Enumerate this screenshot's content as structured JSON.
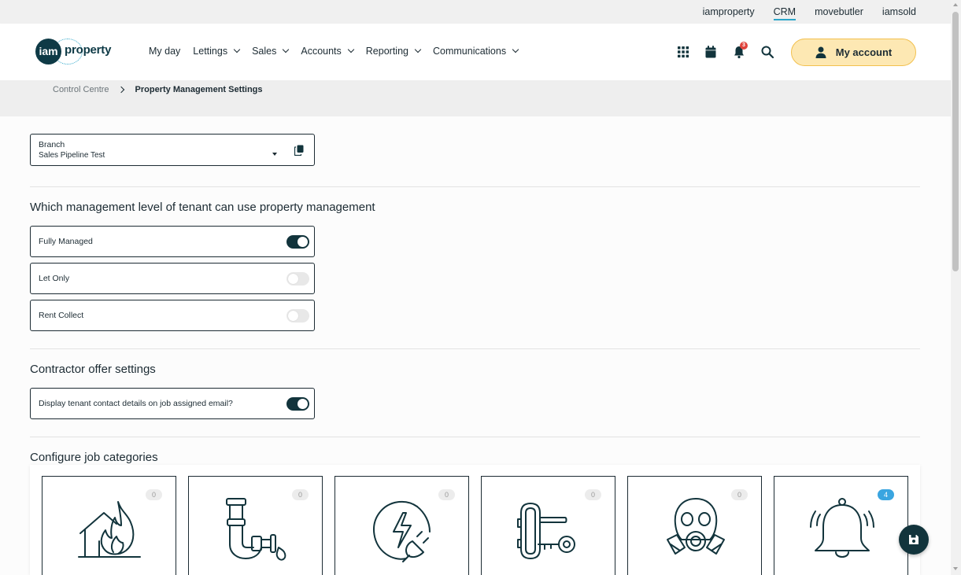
{
  "top_links": [
    {
      "label": "iamproperty",
      "active": false
    },
    {
      "label": "CRM",
      "active": true
    },
    {
      "label": "movebutler",
      "active": false
    },
    {
      "label": "iamsold",
      "active": false
    }
  ],
  "header": {
    "logo_mark": "iam",
    "logo_word": "property",
    "nav": [
      {
        "label": "My day",
        "has_dropdown": false
      },
      {
        "label": "Lettings",
        "has_dropdown": true
      },
      {
        "label": "Sales",
        "has_dropdown": true
      },
      {
        "label": "Accounts",
        "has_dropdown": true
      },
      {
        "label": "Reporting",
        "has_dropdown": true
      },
      {
        "label": "Communications",
        "has_dropdown": true
      }
    ],
    "icons": [
      "apps-grid-icon",
      "calendar-icon",
      "bell-icon",
      "search-icon"
    ],
    "notification_count": "3",
    "account_label": "My account"
  },
  "breadcrumb": {
    "parent": "Control Centre",
    "current": "Property Management Settings"
  },
  "branch": {
    "label": "Branch",
    "value": "Sales Pipeline Test"
  },
  "management": {
    "title": "Which management level of tenant can use property management",
    "options": [
      {
        "label": "Fully Managed",
        "enabled": true
      },
      {
        "label": "Let Only",
        "enabled": false
      },
      {
        "label": "Rent Collect",
        "enabled": false
      }
    ]
  },
  "contractor": {
    "title": "Contractor offer settings",
    "options": [
      {
        "label": "Display tenant contact details on job assigned email?",
        "enabled": true
      }
    ]
  },
  "job_categories": {
    "title": "Configure job categories",
    "cards": [
      {
        "icon": "house-fire-icon",
        "count": "0"
      },
      {
        "icon": "plumbing-pipe-icon",
        "count": "0"
      },
      {
        "icon": "electrical-plug-icon",
        "count": "0"
      },
      {
        "icon": "door-lock-key-icon",
        "count": "0"
      },
      {
        "icon": "gas-mask-icon",
        "count": "0"
      },
      {
        "icon": "alarm-bell-icon",
        "count": "4"
      }
    ]
  },
  "colors": {
    "primary_dark": "#12343c",
    "accent": "#2ba6c9",
    "account_bg": "#fde8b3",
    "account_border": "#f2c04e",
    "badge_red": "#e0443c",
    "count_blue": "#3aa5e0"
  }
}
